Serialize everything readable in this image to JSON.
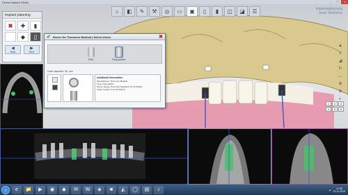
{
  "window": {
    "title": "Dental Implant Studio"
  },
  "planning_panel": {
    "title": "Implant planning",
    "buttons": [
      "✖",
      "✚",
      "▮",
      "",
      "◆",
      "▯"
    ],
    "nav": [
      {
        "arrow": "◀",
        "label": "Back"
      },
      {
        "arrow": "▶",
        "label": "Next"
      }
    ]
  },
  "toolbar": {
    "icons": [
      "⌂",
      "◧",
      "✎",
      "⚒",
      "◎",
      "▭",
      "▣",
      "▯",
      "▮",
      "◫",
      "◪",
      "☰"
    ]
  },
  "brand": {
    "line1": "Implantatplanung",
    "line2": "Janet Teethless"
  },
  "dialog": {
    "title": "Sleeve for Thommen Medical | Select sleeve",
    "sleeves": [
      {
        "label": "Pilot"
      },
      {
        "label": "Fully guided"
      }
    ],
    "option_label": "Outer diameter: 95, mm",
    "info_title": "Additional information",
    "info_lines": [
      "Manufacturer: Thommen Medical",
      "Type: Fully guided",
      "Name: Sleeve Thommen Medical S 27.23 (0016)",
      "Order number: 9.27.23.0016.8"
    ]
  },
  "right_tools": [
    "▲",
    "≡",
    "◢",
    "↻",
    "↔",
    "⊕",
    "⊗",
    "◐"
  ],
  "cubes": [
    "1",
    "2",
    "3",
    "4",
    "5",
    "6"
  ],
  "taskbar": {
    "icons": [
      "e",
      "📁",
      "▶",
      "◉",
      "◆",
      "✉",
      "W",
      "◈",
      "■",
      "◭",
      "◯",
      "▤",
      "♪"
    ],
    "time": "12:08",
    "date": "19.11.2019"
  },
  "colors": {
    "accent": "#3a5fb0",
    "implant_green": "#4cc06a",
    "axis_blue": "#2f5bd0"
  }
}
